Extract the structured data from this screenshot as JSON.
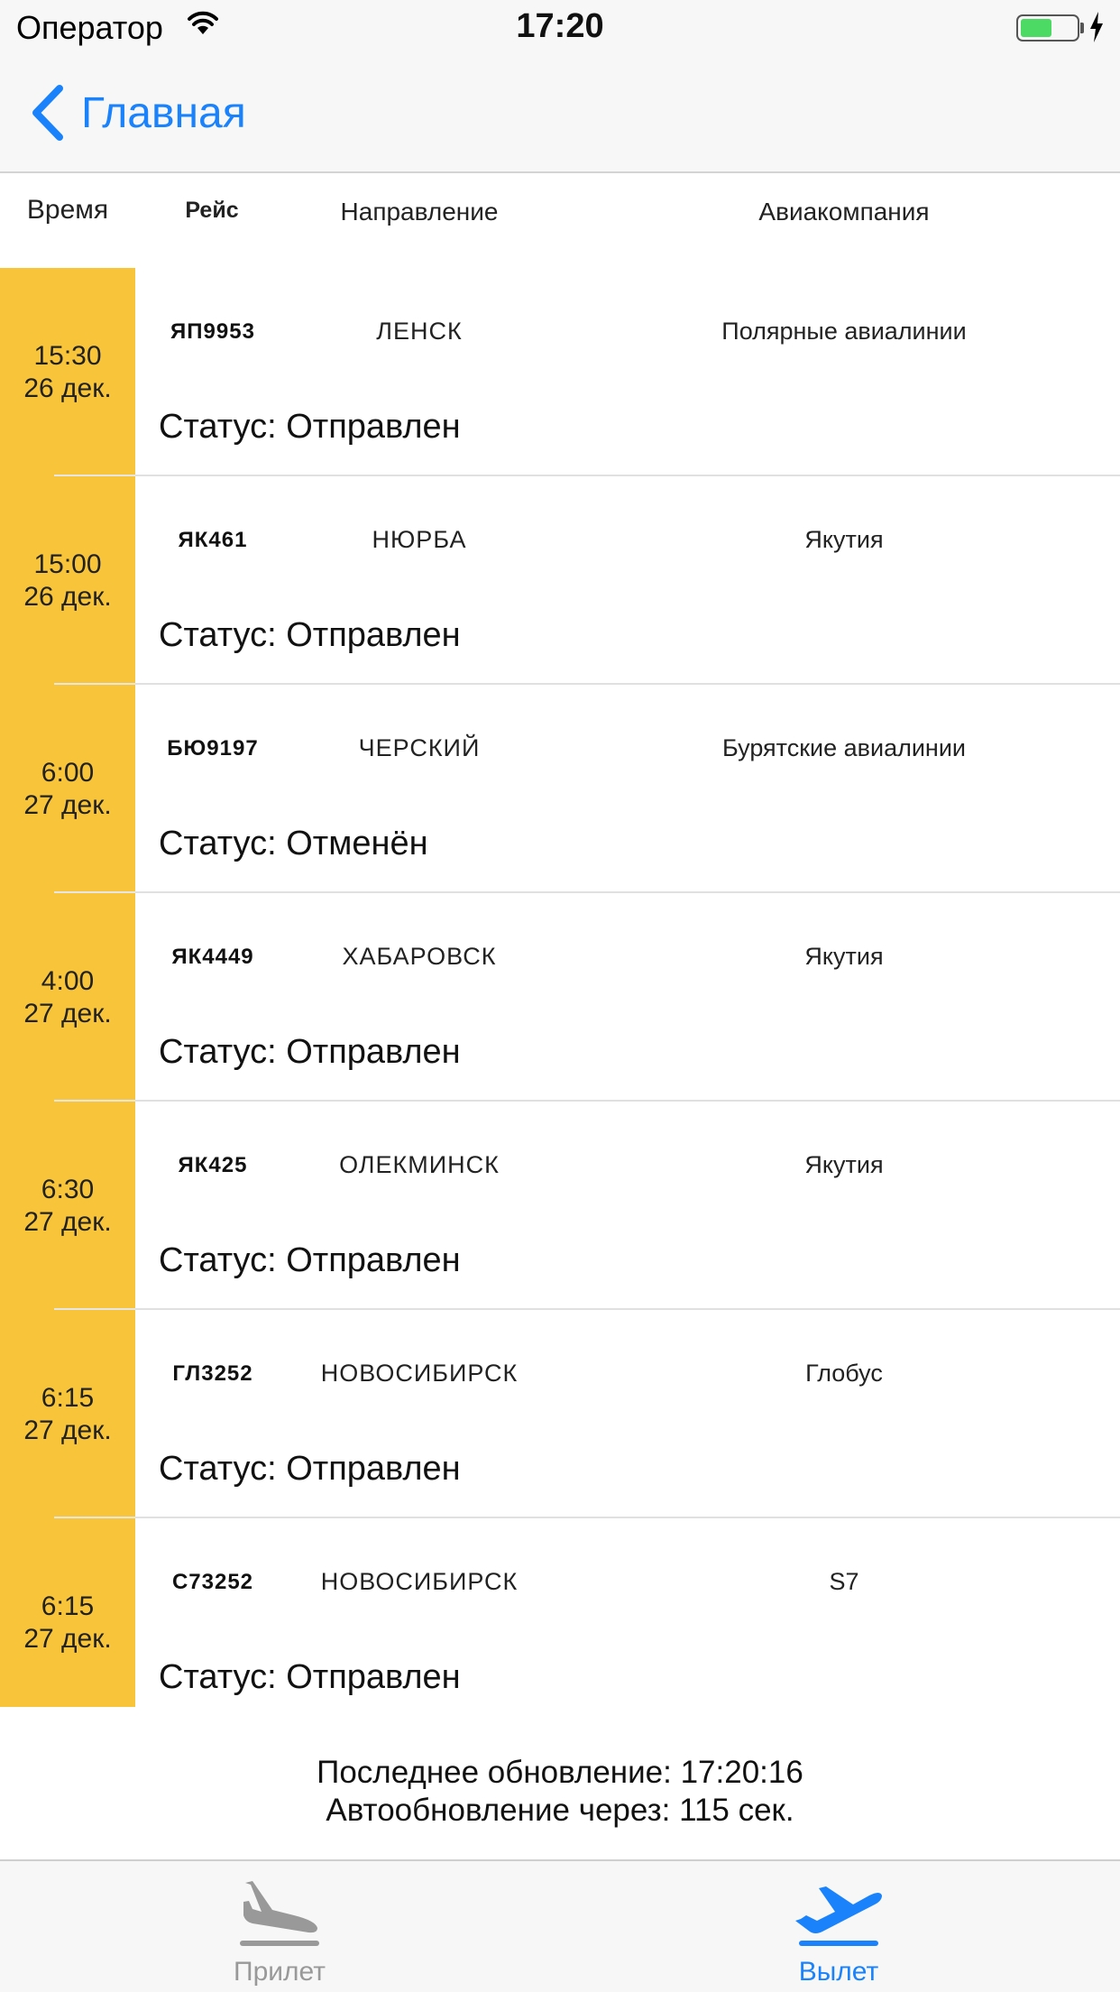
{
  "status_bar": {
    "carrier": "Оператор",
    "time": "17:20"
  },
  "nav": {
    "back_label": "Главная"
  },
  "columns": {
    "time": "Время",
    "flight": "Рейс",
    "destination": "Направление",
    "airline": "Авиакомпания"
  },
  "status_prefix": "Статус:",
  "flights": [
    {
      "time": "15:30",
      "date": "26 дек.",
      "flight": "ЯП9953",
      "destination": "ЛЕНСК",
      "airline": "Полярные авиалинии",
      "status": "Отправлен"
    },
    {
      "time": "15:00",
      "date": "26 дек.",
      "flight": "ЯК461",
      "destination": "НЮРБА",
      "airline": "Якутия",
      "status": "Отправлен"
    },
    {
      "time": "6:00",
      "date": "27 дек.",
      "flight": "БЮ9197",
      "destination": "ЧЕРСКИЙ",
      "airline": "Бурятские авиалинии",
      "status": "Отменён"
    },
    {
      "time": "4:00",
      "date": "27 дек.",
      "flight": "ЯК4449",
      "destination": "ХАБАРОВСК",
      "airline": "Якутия",
      "status": "Отправлен"
    },
    {
      "time": "6:30",
      "date": "27 дек.",
      "flight": "ЯК425",
      "destination": "ОЛЕКМИНСК",
      "airline": "Якутия",
      "status": "Отправлен"
    },
    {
      "time": "6:15",
      "date": "27 дек.",
      "flight": "ГЛ3252",
      "destination": "НОВОСИБИРСК",
      "airline": "Глобус",
      "status": "Отправлен"
    },
    {
      "time": "6:15",
      "date": "27 дек.",
      "flight": "С73252",
      "destination": "НОВОСИБИРСК",
      "airline": "S7",
      "status": "Отправлен"
    }
  ],
  "footer": {
    "last_update": "Последнее обновление: 17:20:16",
    "auto_update": "Автообновление через: 115 сек."
  },
  "tabs": [
    {
      "label": "Прилет",
      "icon": "plane-landing-icon",
      "active": false
    },
    {
      "label": "Вылет",
      "icon": "plane-takeoff-icon",
      "active": true
    }
  ],
  "colors": {
    "accent": "#1a82fb",
    "time_cell": "#f8c53a",
    "inactive_tab": "#999999",
    "battery": "#4cd964"
  }
}
